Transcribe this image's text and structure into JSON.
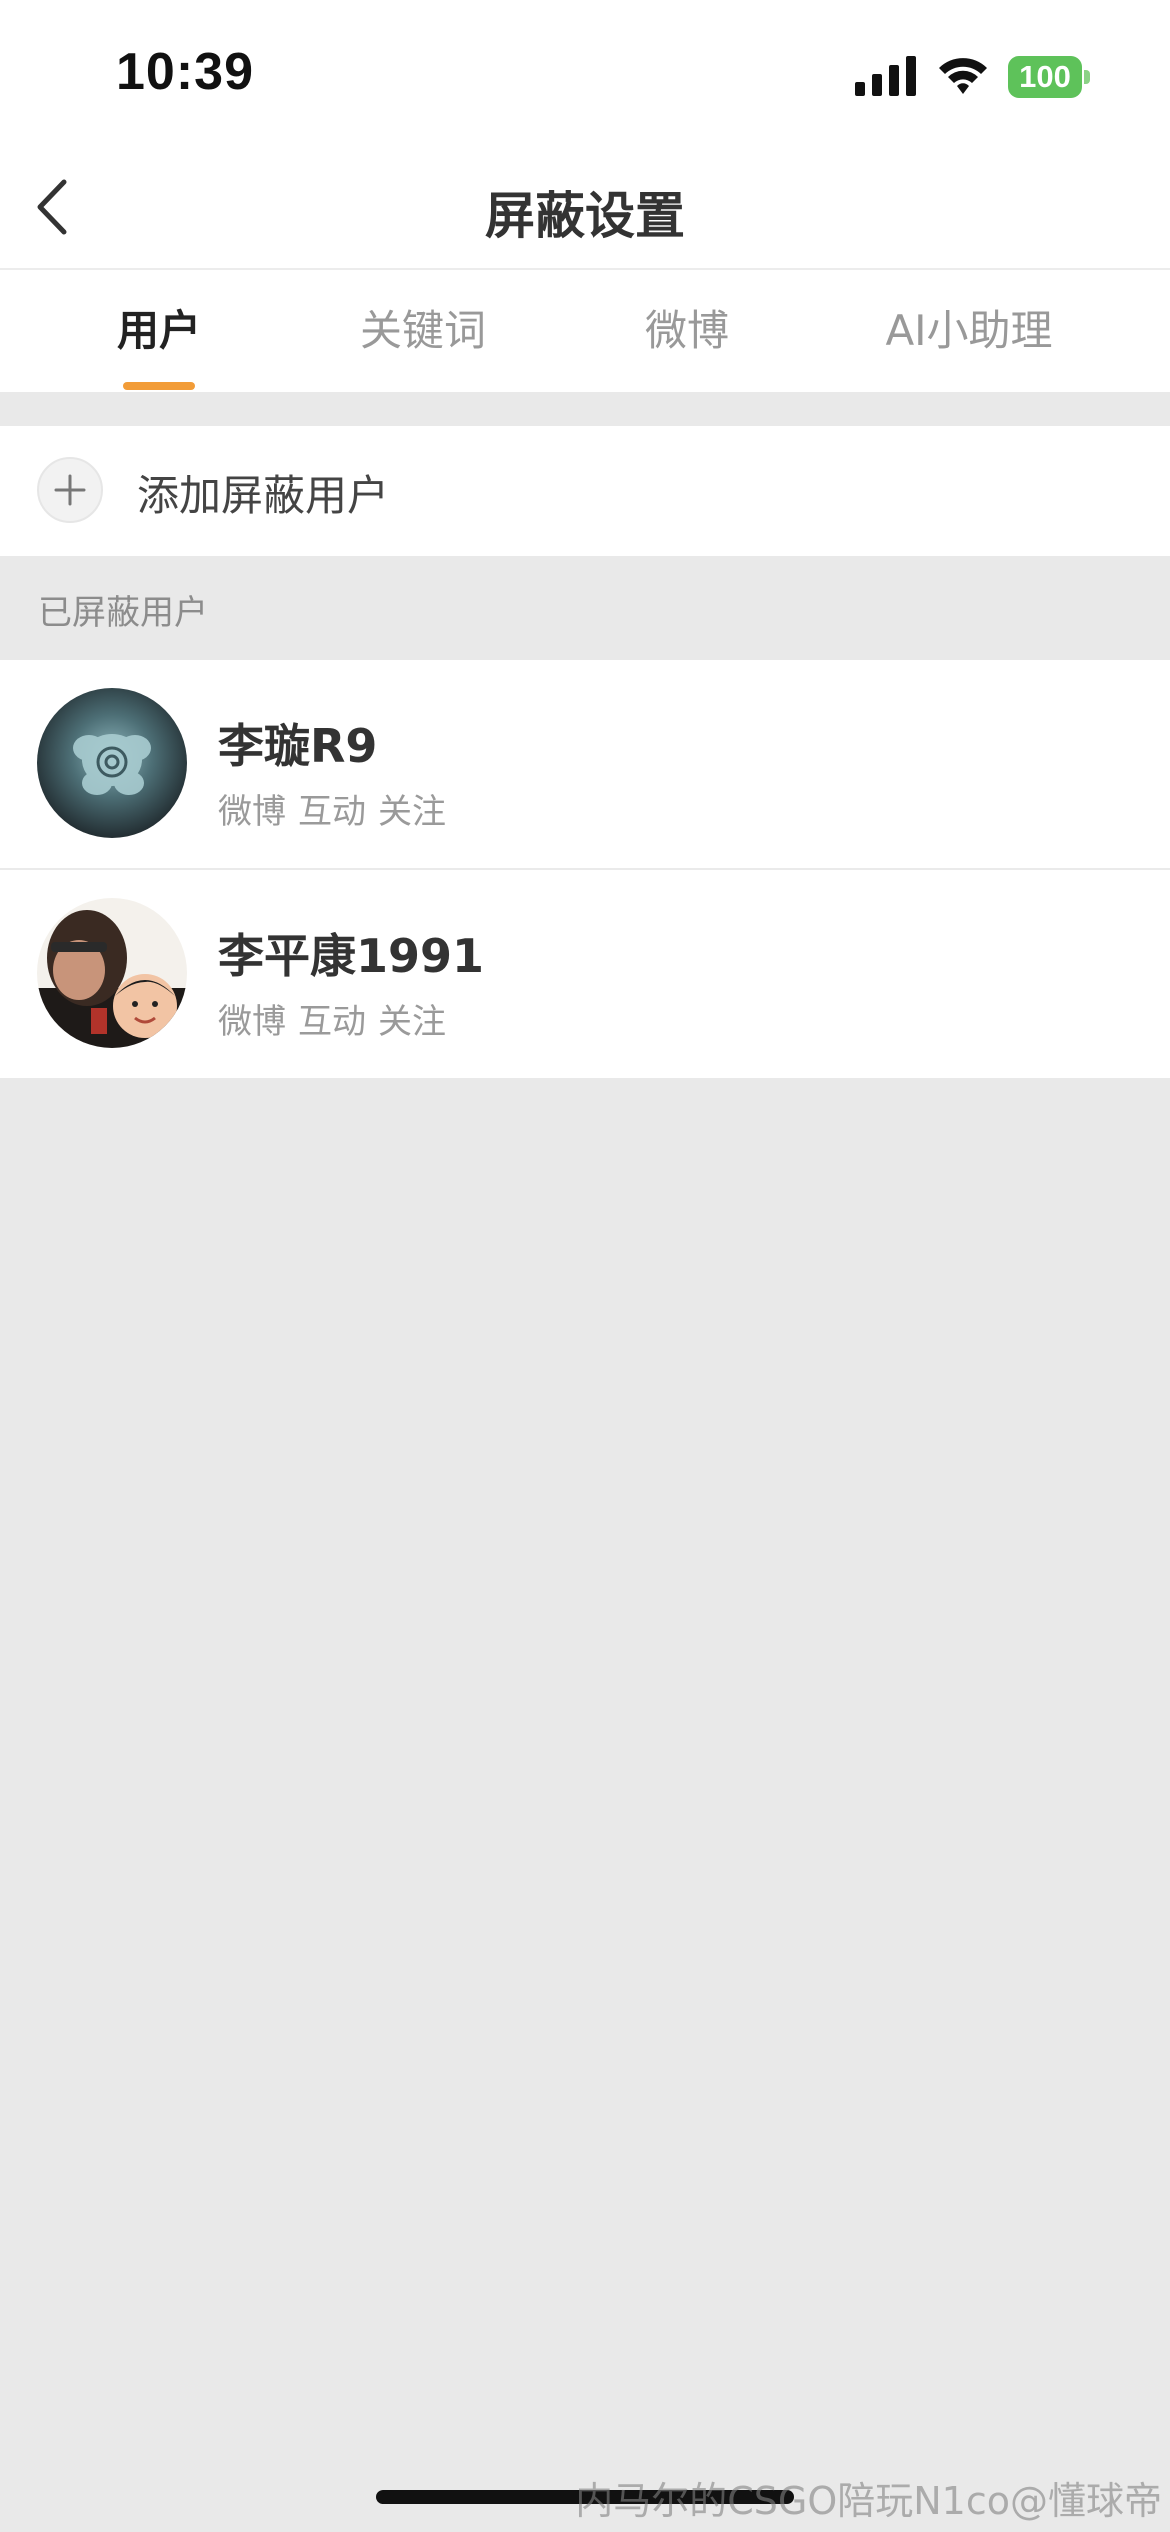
{
  "status_bar": {
    "time": "10:39",
    "battery": "100"
  },
  "nav": {
    "title": "屏蔽设置"
  },
  "tabs": [
    {
      "label": "用户",
      "active": true
    },
    {
      "label": "关键词",
      "active": false
    },
    {
      "label": "微博",
      "active": false
    },
    {
      "label": "AI小助理",
      "active": false
    }
  ],
  "add_user": {
    "label": "添加屏蔽用户"
  },
  "section": {
    "header": "已屏蔽用户"
  },
  "blocked_users": [
    {
      "name": "李璇R9",
      "tags": [
        "微博",
        "互动",
        "关注"
      ]
    },
    {
      "name": "李平康1991",
      "tags": [
        "微博",
        "互动",
        "关注"
      ]
    }
  ],
  "watermark": "内马尔的CSGO陪玩N1co@懂球帝",
  "colors": {
    "accent": "#f29c38",
    "battery": "#5ec25a",
    "background": "#e9e9e9"
  }
}
